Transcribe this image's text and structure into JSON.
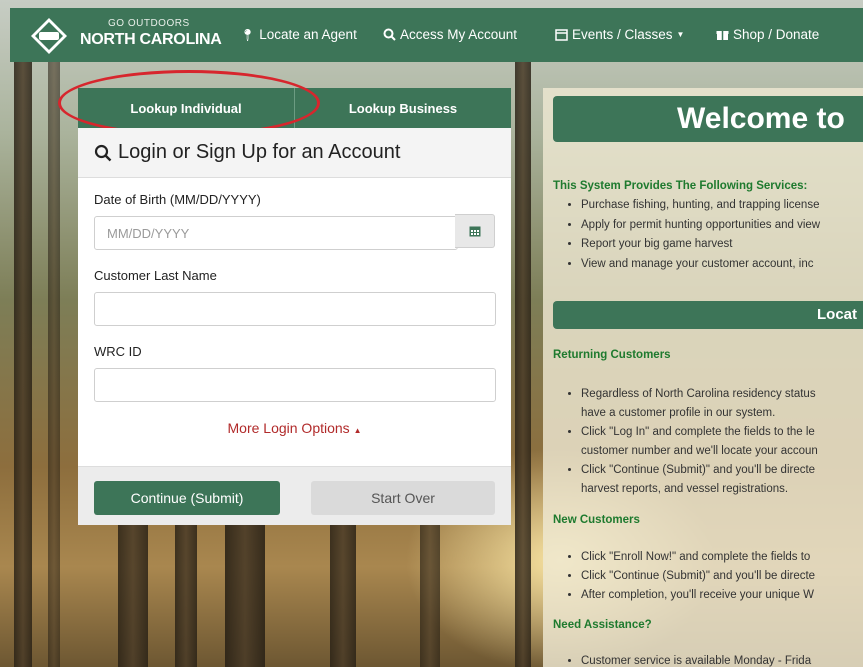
{
  "colors": {
    "brand_green": "#3d7558",
    "link_red": "#b12a2a",
    "heading_green": "#1e7a2e",
    "highlight": "#d7262d"
  },
  "navbar": {
    "brand_top": "GO OUTDOORS",
    "brand_main": "NORTH CAROLINA",
    "items": [
      {
        "label": "Locate an Agent",
        "icon": "map-marker-icon"
      },
      {
        "label": "Access My Account",
        "icon": "search-icon"
      },
      {
        "label": "Events / Classes",
        "icon": "calendar-icon"
      },
      {
        "label": "Shop / Donate",
        "icon": "gift-icon"
      }
    ]
  },
  "login": {
    "tabs": [
      "Lookup Individual",
      "Lookup Business"
    ],
    "title": "Login or Sign Up for an Account",
    "dob_label": "Date of Birth (MM/DD/YYYY)",
    "dob_placeholder": "MM/DD/YYYY",
    "last_name_label": "Customer Last Name",
    "wrc_label": "WRC ID",
    "more_options": "More Login Options",
    "continue_label": "Continue (Submit)",
    "start_over_label": "Start Over"
  },
  "welcome": {
    "title": "Welcome to",
    "services_head": "This System Provides The Following Services:",
    "services": [
      "Purchase fishing, hunting, and trapping license",
      "Apply for permit hunting opportunities and view",
      "Report your big game harvest",
      "View and manage your customer account, inc"
    ],
    "locate_bar": "Locat",
    "returning_head": "Returning Customers",
    "returning_lines": [
      "Regardless of North Carolina residency status",
      "have a customer profile in our system.",
      "Click \"Log In\" and complete the fields to the le",
      "customer number and we'll locate your accoun",
      "Click \"Continue (Submit)\" and you'll be directe",
      "harvest reports, and vessel registrations."
    ],
    "new_head": "New Customers",
    "new_lines": [
      "Click \"Enroll Now!\" and complete the fields to",
      "Click \"Continue (Submit)\" and you'll be directe",
      "After completion, you'll receive your unique W"
    ],
    "assist_head": "Need Assistance?",
    "assist_lines": [
      "Customer service is available Monday - Frida"
    ]
  }
}
